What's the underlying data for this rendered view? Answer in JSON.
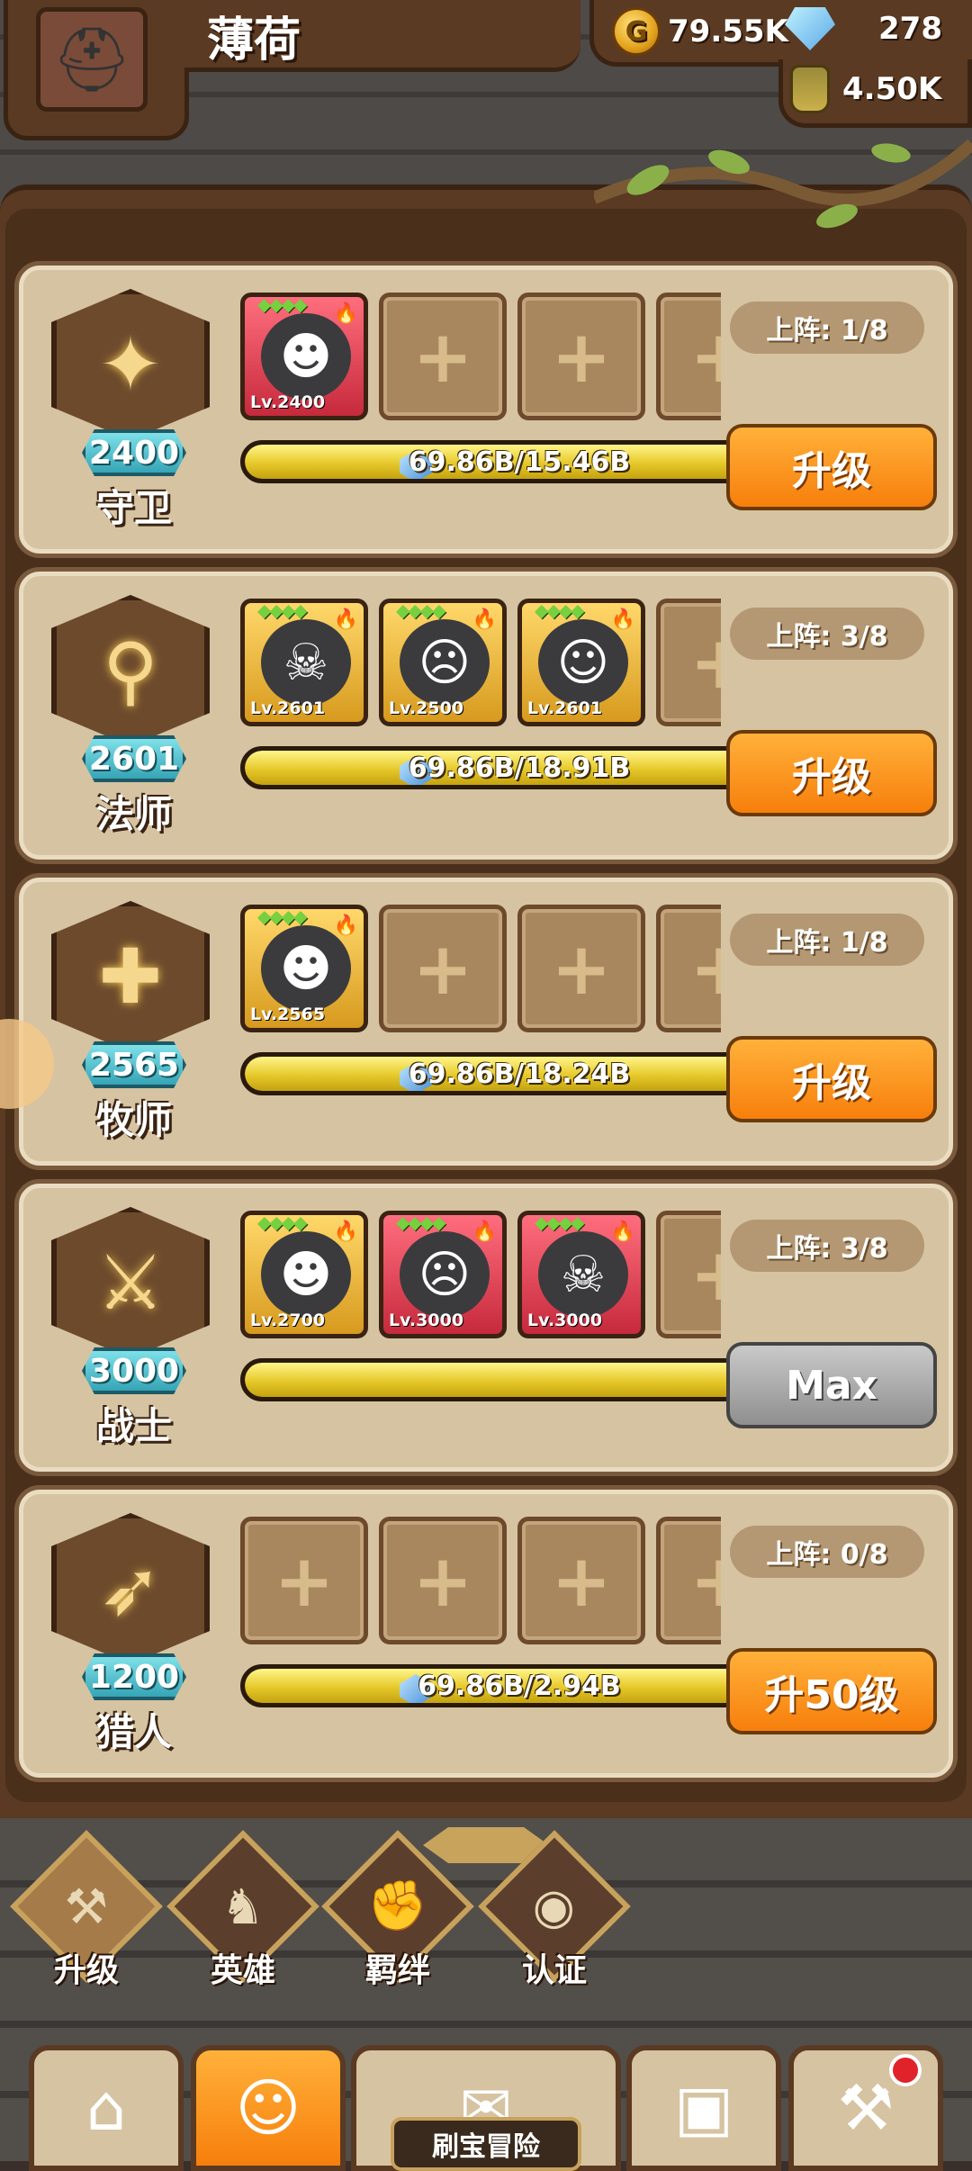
{
  "player": {
    "name": "薄荷"
  },
  "resources": {
    "gold": "79.55K",
    "gems": "278",
    "potion": "4.50K"
  },
  "classes": [
    {
      "name": "守卫",
      "level": "2400",
      "glyph": "✦",
      "slots_label": "上阵: 1/8",
      "xp_text": "69.86B/15.46B",
      "xp_fill": 1.0,
      "button": "升级",
      "max": false,
      "heroes": [
        {
          "lv": "Lv.2400",
          "color": "red",
          "face": "☻"
        },
        null,
        null,
        null
      ]
    },
    {
      "name": "法师",
      "level": "2601",
      "glyph": "⚲",
      "slots_label": "上阵: 3/8",
      "xp_text": "69.86B/18.91B",
      "xp_fill": 1.0,
      "button": "升级",
      "max": false,
      "heroes": [
        {
          "lv": "Lv.2601",
          "color": "gold",
          "face": "☠"
        },
        {
          "lv": "Lv.2500",
          "color": "gold",
          "face": "☹"
        },
        {
          "lv": "Lv.2601",
          "color": "gold",
          "face": "☺"
        },
        null
      ]
    },
    {
      "name": "牧师",
      "level": "2565",
      "glyph": "✚",
      "slots_label": "上阵: 1/8",
      "xp_text": "69.86B/18.24B",
      "xp_fill": 1.0,
      "button": "升级",
      "max": false,
      "heroes": [
        {
          "lv": "Lv.2565",
          "color": "gold",
          "face": "☻"
        },
        null,
        null,
        null
      ]
    },
    {
      "name": "战士",
      "level": "3000",
      "glyph": "⚔",
      "slots_label": "上阵: 3/8",
      "xp_text": "",
      "xp_fill": 1.0,
      "button": "Max",
      "max": true,
      "heroes": [
        {
          "lv": "Lv.2700",
          "color": "gold",
          "face": "☻"
        },
        {
          "lv": "Lv.3000",
          "color": "red",
          "face": "☹"
        },
        {
          "lv": "Lv.3000",
          "color": "red",
          "face": "☠"
        },
        null
      ]
    },
    {
      "name": "猎人",
      "level": "1200",
      "glyph": "➶",
      "slots_label": "上阵: 0/8",
      "xp_text": "69.86B/2.94B",
      "xp_fill": 1.0,
      "button": "升50级",
      "max": false,
      "heroes": [
        null,
        null,
        null,
        null
      ]
    }
  ],
  "nav": [
    {
      "label": "升级",
      "icon": "⚒"
    },
    {
      "label": "英雄",
      "icon": "♞"
    },
    {
      "label": "羁绊",
      "icon": "✊"
    },
    {
      "label": "认证",
      "icon": "◉"
    }
  ],
  "tabs": [
    {
      "icon": "⌂",
      "name": "shop-tab"
    },
    {
      "icon": "☺",
      "name": "hero-tab"
    },
    {
      "icon": "✉",
      "name": "adventure-tab"
    },
    {
      "icon": "▣",
      "name": "bag-tab"
    },
    {
      "icon": "⚒",
      "name": "forge-tab"
    }
  ],
  "adventure_label": "刷宝冒险"
}
